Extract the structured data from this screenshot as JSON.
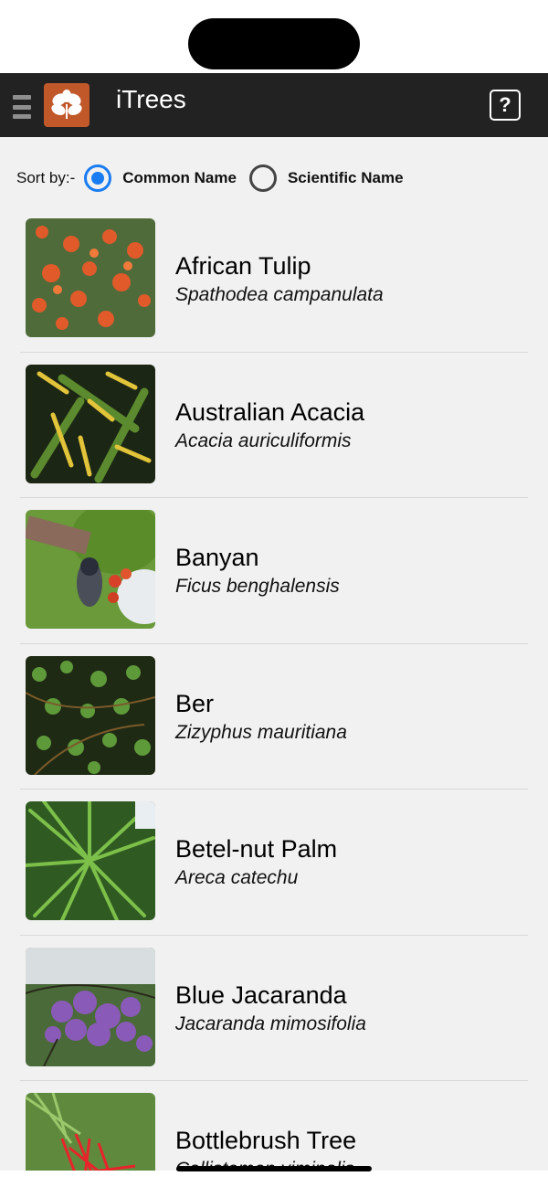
{
  "app": {
    "title": "iTrees",
    "menu_icon": "hamburger-icon",
    "logo_icon": "leaf-logo-icon",
    "help_icon": "help-icon",
    "help_label": "?"
  },
  "sort": {
    "label": "Sort by:-",
    "options": [
      {
        "label": "Common Name",
        "selected": true
      },
      {
        "label": "Scientific Name",
        "selected": false
      }
    ]
  },
  "colors": {
    "app_bar": "#222222",
    "accent": "#1a7cf2",
    "logo_bg": "#c0582a",
    "list_bg": "#f1f1f1"
  },
  "trees": [
    {
      "common": "African Tulip",
      "scientific": "Spathodea campanulata"
    },
    {
      "common": "Australian Acacia",
      "scientific": "Acacia auriculiformis"
    },
    {
      "common": "Banyan",
      "scientific": "Ficus benghalensis"
    },
    {
      "common": "Ber",
      "scientific": "Zizyphus mauritiana"
    },
    {
      "common": "Betel-nut Palm",
      "scientific": "Areca catechu"
    },
    {
      "common": "Blue Jacaranda",
      "scientific": "Jacaranda mimosifolia"
    },
    {
      "common": "Bottlebrush Tree",
      "scientific": "Callistemon viminalis"
    }
  ]
}
